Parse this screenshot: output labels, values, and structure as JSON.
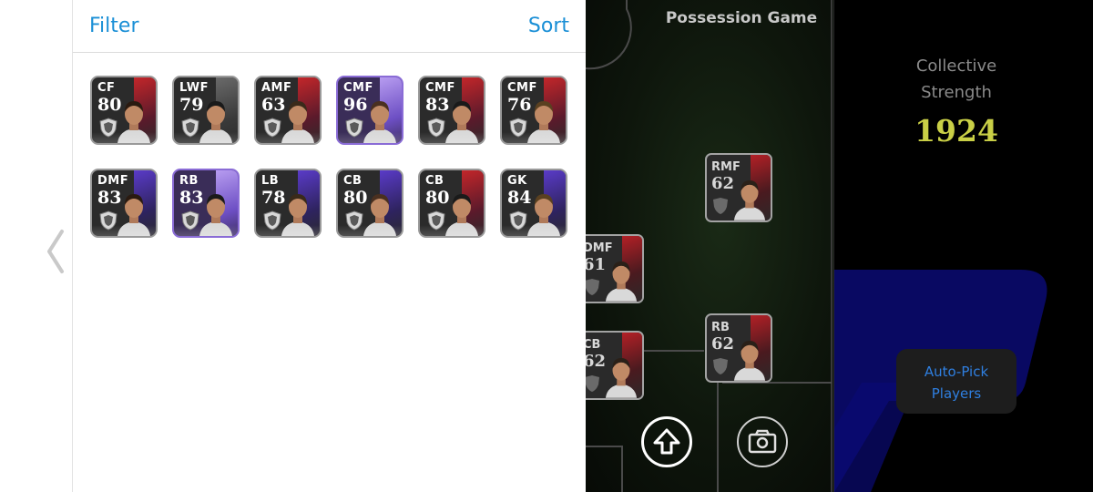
{
  "panel": {
    "filter_label": "Filter",
    "sort_label": "Sort",
    "players": [
      {
        "position": "CF",
        "rating": "80",
        "stripe": "red"
      },
      {
        "position": "LWF",
        "rating": "79",
        "stripe": "gray"
      },
      {
        "position": "AMF",
        "rating": "63",
        "stripe": "red"
      },
      {
        "position": "CMF",
        "rating": "96",
        "stripe": "violet",
        "featured": true
      },
      {
        "position": "CMF",
        "rating": "83",
        "stripe": "red"
      },
      {
        "position": "CMF",
        "rating": "76",
        "stripe": "red"
      },
      {
        "position": "DMF",
        "rating": "83",
        "stripe": "purple"
      },
      {
        "position": "RB",
        "rating": "83",
        "stripe": "violet",
        "featured": true
      },
      {
        "position": "LB",
        "rating": "78",
        "stripe": "purple"
      },
      {
        "position": "CB",
        "rating": "80",
        "stripe": "purple"
      },
      {
        "position": "CB",
        "rating": "80",
        "stripe": "red"
      },
      {
        "position": "GK",
        "rating": "84",
        "stripe": "purple"
      }
    ]
  },
  "field": {
    "title": "Possession Game",
    "lineup": [
      {
        "position": "RMF",
        "rating": "62"
      },
      {
        "position": "DMF",
        "rating": "61"
      },
      {
        "position": "CB",
        "rating": "62"
      },
      {
        "position": "RB",
        "rating": "62"
      }
    ],
    "icons": {
      "upload": "upload-arrow-icon",
      "camera": "camera-icon"
    }
  },
  "team": {
    "strength_label_line1": "Collective",
    "strength_label_line2": "Strength",
    "strength_value": "1924",
    "autopick_line1": "Auto-Pick",
    "autopick_line2": "Players"
  },
  "colors": {
    "accent_blue": "#1a8fd6",
    "strength_yellow": "#c9cf46",
    "autopick_text": "#2f7fe0"
  }
}
